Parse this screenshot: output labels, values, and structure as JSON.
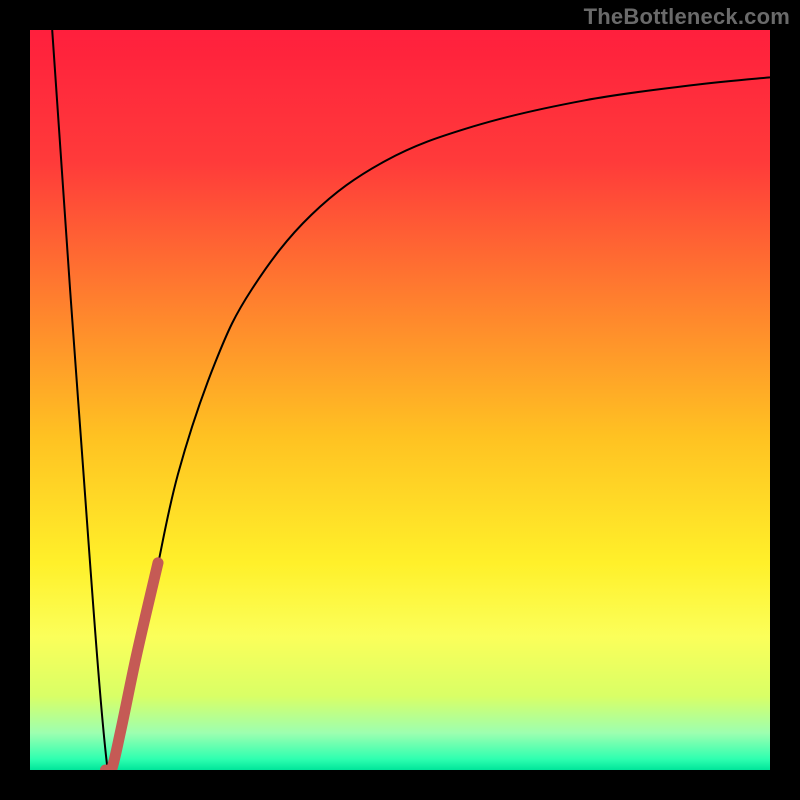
{
  "watermark": "TheBottleneck.com",
  "chart_data": {
    "type": "line",
    "title": "",
    "xlabel": "",
    "ylabel": "",
    "xlim": [
      0,
      100
    ],
    "ylim": [
      0,
      100
    ],
    "gradient_stops": [
      {
        "offset": 0.0,
        "color": "#ff1f3d"
      },
      {
        "offset": 0.18,
        "color": "#ff3b3a"
      },
      {
        "offset": 0.35,
        "color": "#ff7a2f"
      },
      {
        "offset": 0.55,
        "color": "#ffc222"
      },
      {
        "offset": 0.72,
        "color": "#fff02a"
      },
      {
        "offset": 0.82,
        "color": "#fbff5a"
      },
      {
        "offset": 0.9,
        "color": "#d9ff66"
      },
      {
        "offset": 0.95,
        "color": "#9dffb0"
      },
      {
        "offset": 0.985,
        "color": "#2fffb0"
      },
      {
        "offset": 1.0,
        "color": "#00e59a"
      }
    ],
    "series": [
      {
        "name": "bottleneck-curve",
        "color": "#000000",
        "width": 2,
        "points": [
          {
            "x": 3.0,
            "y": 100.0
          },
          {
            "x": 6.5,
            "y": 50.0
          },
          {
            "x": 10.5,
            "y": 0.0
          },
          {
            "x": 12.3,
            "y": 5.5
          },
          {
            "x": 16.5,
            "y": 24.0
          },
          {
            "x": 20.0,
            "y": 40.0
          },
          {
            "x": 25.0,
            "y": 55.0
          },
          {
            "x": 30.0,
            "y": 65.0
          },
          {
            "x": 38.0,
            "y": 75.0
          },
          {
            "x": 48.0,
            "y": 82.3
          },
          {
            "x": 60.0,
            "y": 87.0
          },
          {
            "x": 75.0,
            "y": 90.5
          },
          {
            "x": 90.0,
            "y": 92.6
          },
          {
            "x": 100.0,
            "y": 93.6
          }
        ]
      },
      {
        "name": "highlight-segment",
        "color": "#c55a55",
        "width": 11,
        "points": [
          {
            "x": 10.2,
            "y": 0.0
          },
          {
            "x": 11.0,
            "y": 0.0
          },
          {
            "x": 12.3,
            "y": 5.5
          },
          {
            "x": 14.5,
            "y": 16.0
          },
          {
            "x": 17.3,
            "y": 28.0
          }
        ]
      }
    ]
  }
}
